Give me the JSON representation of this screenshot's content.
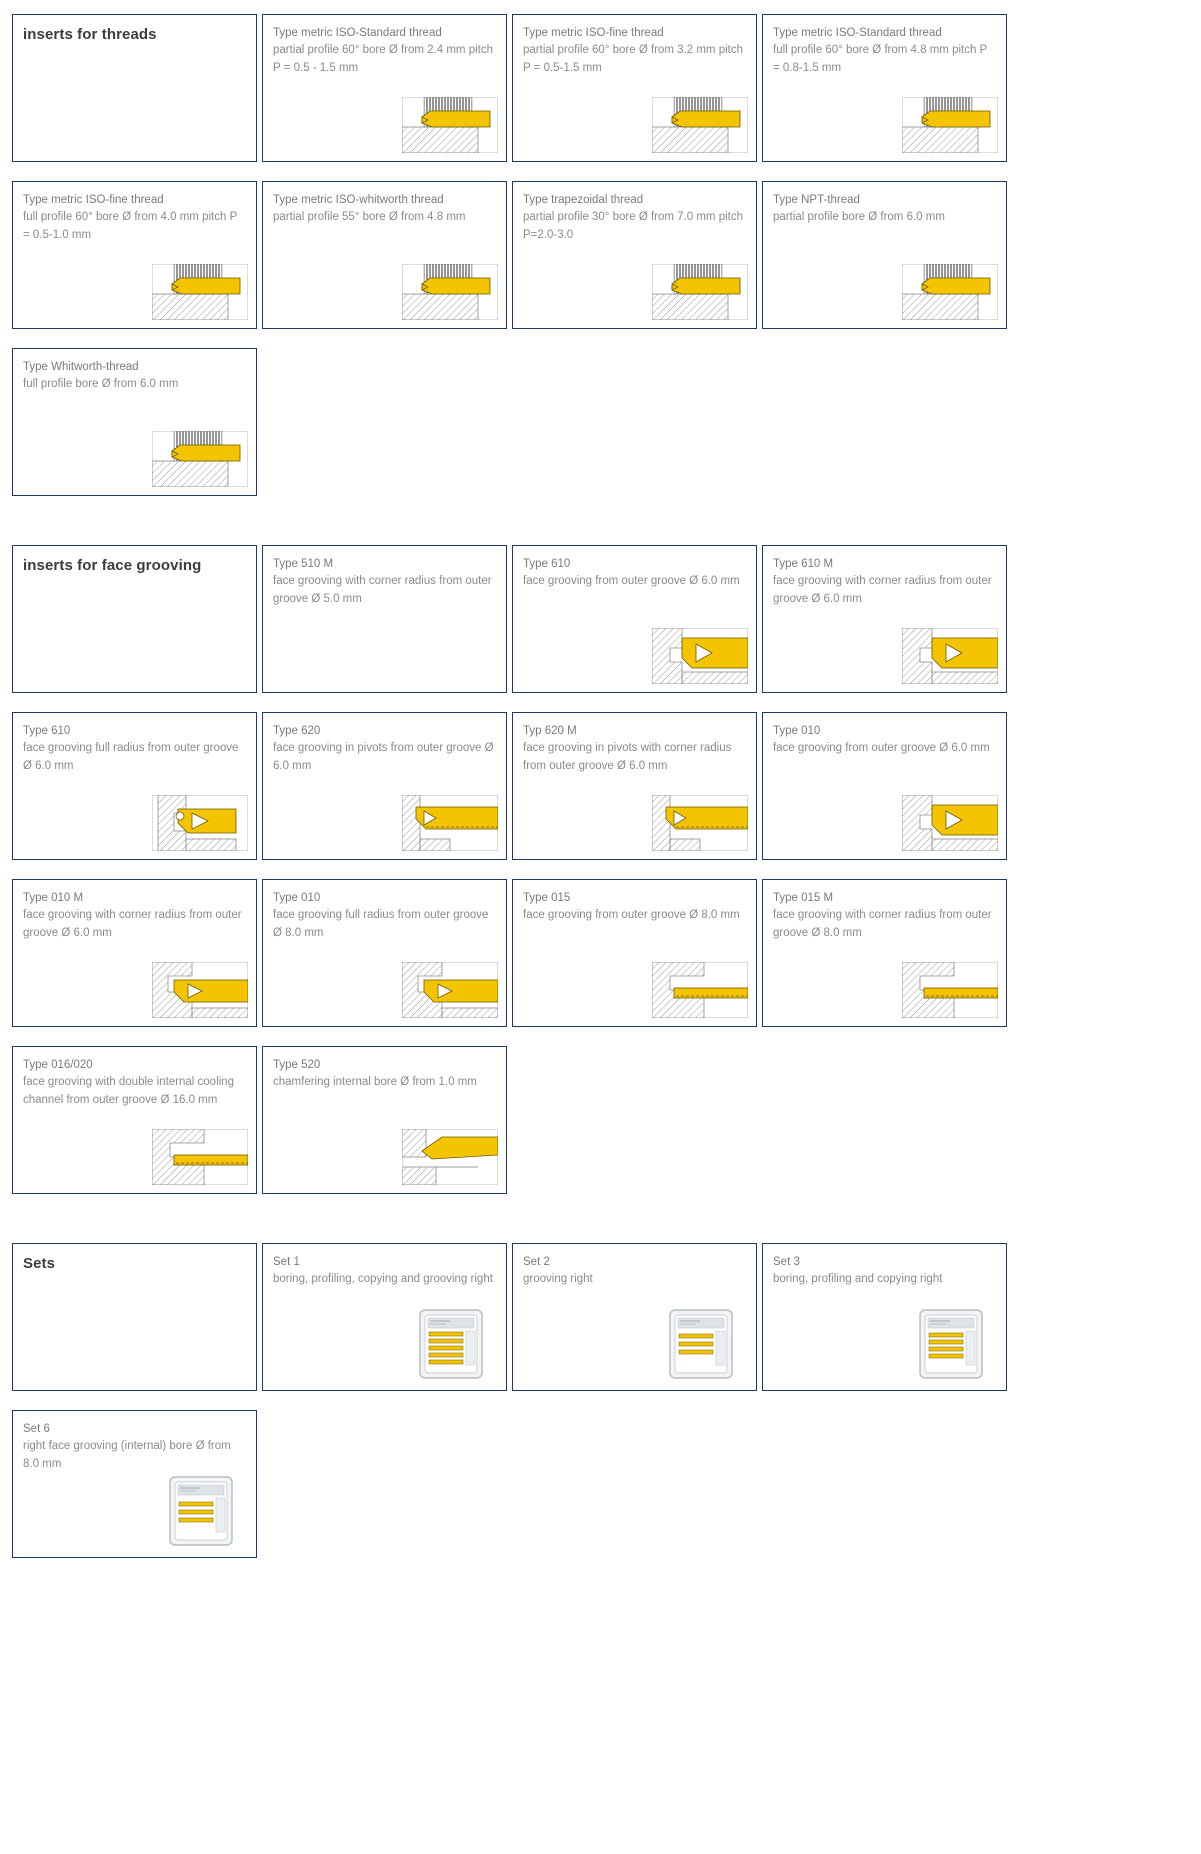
{
  "sections": [
    {
      "id": "threads",
      "heading": "inserts for threads",
      "figure_kind": "thread",
      "cards": [
        {
          "title": "Type metric ISO-Standard thread",
          "desc": "partial profile 60° bore Ø from 2.4 mm pitch P = 0.5 - 1.5 mm",
          "figure": "thread-partial"
        },
        {
          "title": "Type metric ISO-fine thread",
          "desc": "partial profile 60° bore Ø from 3.2 mm pitch P = 0.5-1.5 mm",
          "figure": "thread-partial"
        },
        {
          "title": "Type metric ISO-Standard thread",
          "desc": "full profile 60° bore Ø from 4.8 mm pitch P = 0.8-1.5 mm",
          "figure": "thread-full"
        },
        {
          "title": "Type metric ISO-fine thread",
          "desc": "full profile 60° bore Ø from 4.0 mm pitch P = 0.5-1.0 mm",
          "figure": "thread-full"
        },
        {
          "title": "Type metric ISO-whitworth thread",
          "desc": "partial profile 55° bore Ø from 4.8 mm",
          "figure": "thread-partial"
        },
        {
          "title": "Type trapezoidal thread",
          "desc": "partial profile 30° bore Ø from 7.0 mm pitch P=2.0-3.0",
          "figure": "thread-partial"
        },
        {
          "title": "Type NPT-thread",
          "desc": "partial profile bore Ø from 6.0 mm",
          "figure": "thread-full"
        },
        {
          "title": "Type Whitworth-thread",
          "desc": "full profile bore Ø from 6.0 mm",
          "figure": "thread-full"
        }
      ]
    },
    {
      "id": "face-grooving",
      "heading": "inserts for face grooving",
      "figure_kind": "groove",
      "cards": [
        {
          "title": "Type 510 M",
          "desc": "face grooving with corner radius from outer groove Ø 5.0 mm",
          "figure": "none"
        },
        {
          "title": "Type 610",
          "desc": "face grooving from outer groove Ø 6.0 mm",
          "figure": "groove-a"
        },
        {
          "title": "Type 610 M",
          "desc": "face grooving with corner radius from outer groove Ø 6.0 mm",
          "figure": "groove-a"
        },
        {
          "title": "Type 610",
          "desc": "face grooving full radius from outer groove Ø 6.0 mm",
          "figure": "groove-b"
        },
        {
          "title": "Type 620",
          "desc": "face grooving in pivots from outer groove Ø 6.0 mm",
          "figure": "groove-c"
        },
        {
          "title": "Typ 620 M",
          "desc": "face grooving in pivots with corner radius from outer groove Ø 6.0 mm",
          "figure": "groove-c"
        },
        {
          "title": "Type 010",
          "desc": "face grooving from outer groove Ø 6.0 mm",
          "figure": "groove-a"
        },
        {
          "title": "Type 010 M",
          "desc": "face grooving with corner radius from outer groove Ø 6.0 mm",
          "figure": "groove-d"
        },
        {
          "title": "Type 010",
          "desc": "face grooving full radius from outer groove Ø 8.0 mm",
          "figure": "groove-d"
        },
        {
          "title": "Type 015",
          "desc": "face grooving from outer groove Ø 8.0 mm",
          "figure": "groove-e"
        },
        {
          "title": "Type 015 M",
          "desc": "face grooving with corner radius from outer groove Ø 8.0 mm",
          "figure": "groove-e"
        },
        {
          "title": "Type 016/020",
          "desc": "face grooving with double internal cooling channel from outer groove Ø 16.0 mm",
          "figure": "groove-f"
        },
        {
          "title": "Type 520",
          "desc": "chamfering internal bore Ø from 1.0 mm",
          "figure": "chamfer"
        }
      ]
    },
    {
      "id": "sets",
      "heading": "Sets",
      "figure_kind": "set",
      "cards": [
        {
          "title": "Set 1",
          "desc": "boring, profiling, copying and grooving right",
          "figure": "set-case"
        },
        {
          "title": "Set 2",
          "desc": "grooving right",
          "figure": "set-case"
        },
        {
          "title": "Set 3",
          "desc": "boring, profiling and copying right",
          "figure": "set-case"
        },
        {
          "title": "Set 6",
          "desc": "right face grooving (internal) bore Ø from 8.0 mm",
          "figure": "set-case"
        }
      ]
    }
  ],
  "colors": {
    "border": "#1f3864",
    "heading_text": "#3c3c3b",
    "body_text": "#8a8a8a",
    "insert_yellow": "#f5c400",
    "hatch_gray": "#9a9a9a"
  }
}
